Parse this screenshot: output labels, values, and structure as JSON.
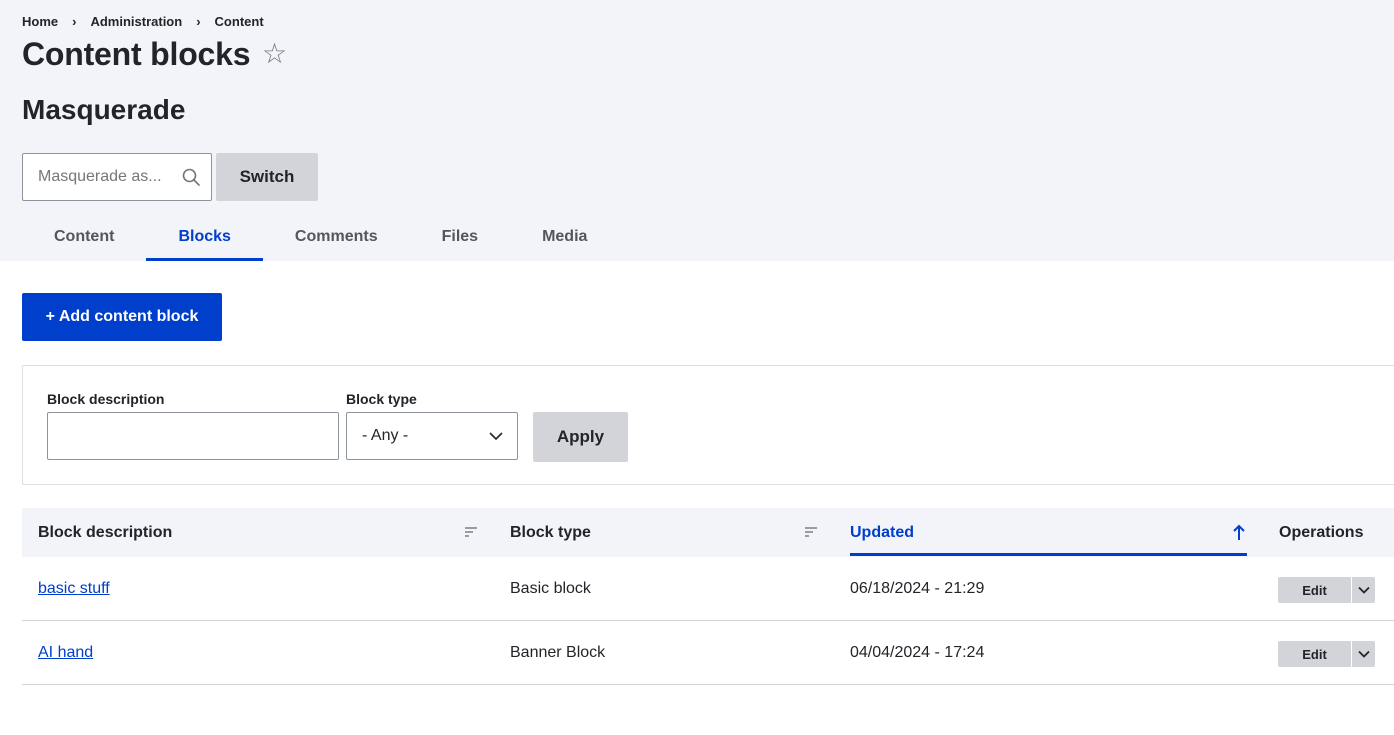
{
  "breadcrumb": {
    "items": [
      "Home",
      "Administration",
      "Content"
    ],
    "separator": "›"
  },
  "page": {
    "title": "Content blocks",
    "star_glyph": "☆"
  },
  "masquerade": {
    "title": "Masquerade",
    "input_placeholder": "Masquerade as...",
    "switch_label": "Switch"
  },
  "tabs": [
    {
      "label": "Content",
      "active": false
    },
    {
      "label": "Blocks",
      "active": true
    },
    {
      "label": "Comments",
      "active": false
    },
    {
      "label": "Files",
      "active": false
    },
    {
      "label": "Media",
      "active": false
    }
  ],
  "actions": {
    "add_label": "+ Add content block"
  },
  "filters": {
    "description_label": "Block description",
    "description_value": "",
    "type_label": "Block type",
    "type_selected": "- Any -",
    "apply_label": "Apply"
  },
  "table": {
    "headers": {
      "description": "Block description",
      "type": "Block type",
      "updated": "Updated",
      "operations": "Operations"
    },
    "sorted_column": "updated",
    "rows": [
      {
        "description": "basic stuff",
        "type": "Basic block",
        "updated": "06/18/2024 - 21:29",
        "op_label": "Edit"
      },
      {
        "description": "AI hand",
        "type": "Banner Block",
        "updated": "04/04/2024 - 17:24",
        "op_label": "Edit"
      }
    ]
  },
  "colors": {
    "accent": "#003ecc",
    "header_bg": "#f3f4f9",
    "button_gray": "#d3d4d9",
    "text": "#232429"
  }
}
